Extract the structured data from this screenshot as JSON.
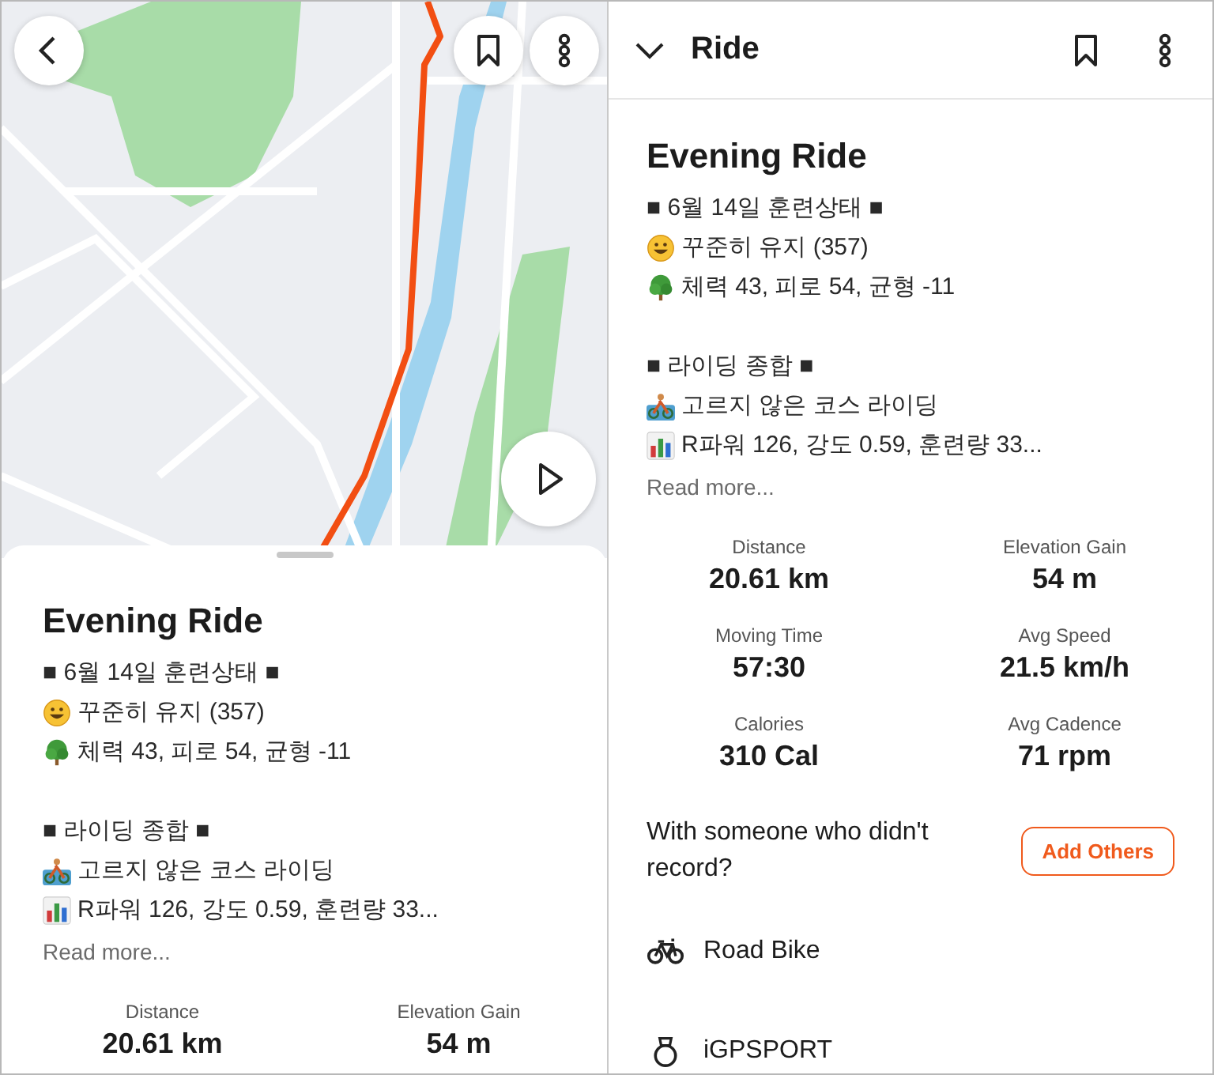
{
  "map_screen": {
    "sheet": {
      "title": "Evening Ride",
      "description": [
        {
          "lines": [
            {
              "kind": "plain",
              "text": "■ 6월 14일 훈련상태 ■"
            },
            {
              "kind": "smiley",
              "text": "꾸준히 유지 (357)"
            },
            {
              "kind": "tree",
              "text": "체력 43, 피로 54, 균형 -11"
            }
          ]
        },
        {
          "lines": [
            {
              "kind": "plain",
              "text": "■ 라이딩 종합 ■"
            },
            {
              "kind": "cyclist",
              "text": "고르지 않은 코스 라이딩"
            },
            {
              "kind": "chart",
              "text": "R파워 126, 강도 0.59, 훈련량 33..."
            }
          ]
        }
      ],
      "read_more": "Read more...",
      "stats": [
        {
          "label": "Distance",
          "value": "20.61 km"
        },
        {
          "label": "Elevation Gain",
          "value": "54 m"
        }
      ]
    }
  },
  "detail_screen": {
    "header": {
      "title": "Ride"
    },
    "title": "Evening Ride",
    "description": [
      {
        "lines": [
          {
            "kind": "plain",
            "text": "■ 6월 14일 훈련상태 ■"
          },
          {
            "kind": "smiley",
            "text": "꾸준히 유지 (357)"
          },
          {
            "kind": "tree",
            "text": "체력 43, 피로 54, 균형 -11"
          }
        ]
      },
      {
        "lines": [
          {
            "kind": "plain",
            "text": "■ 라이딩 종합 ■"
          },
          {
            "kind": "cyclist",
            "text": "고르지 않은 코스 라이딩"
          },
          {
            "kind": "chart",
            "text": "R파워 126, 강도 0.59, 훈련량 33..."
          }
        ]
      }
    ],
    "read_more": "Read more...",
    "stats": [
      {
        "label": "Distance",
        "value": "20.61 km"
      },
      {
        "label": "Elevation Gain",
        "value": "54 m"
      },
      {
        "label": "Moving Time",
        "value": "57:30"
      },
      {
        "label": "Avg Speed",
        "value": "21.5 km/h"
      },
      {
        "label": "Calories",
        "value": "310 Cal"
      },
      {
        "label": "Avg Cadence",
        "value": "71 rpm"
      }
    ],
    "prompt": "With someone who didn't record?",
    "add_button": "Add Others",
    "gear": [
      {
        "kind": "bike",
        "label": "Road Bike"
      },
      {
        "kind": "device",
        "label": "iGPSPORT"
      }
    ]
  }
}
